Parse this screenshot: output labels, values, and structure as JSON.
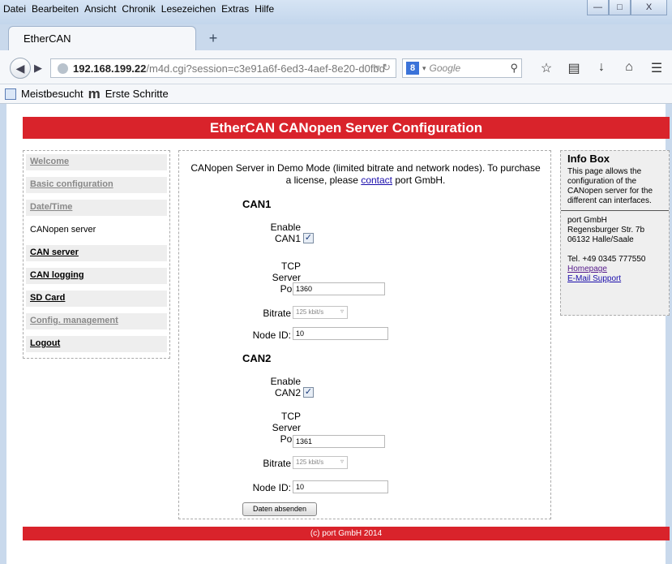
{
  "menu": {
    "items": [
      "Datei",
      "Bearbeiten",
      "Ansicht",
      "Chronik",
      "Lesezeichen",
      "Extras",
      "Hilfe"
    ]
  },
  "window_controls": {
    "minimize": "—",
    "maximize": "□",
    "close": "X"
  },
  "tab": {
    "title": "EtherCAN",
    "new_tab": "+"
  },
  "navbar": {
    "url_host": "192.168.199.22",
    "url_path": "/m4d.cgi?session=c3e91a6f-6ed3-4aef-8e20-d0fbd",
    "search_engine": "8",
    "search_placeholder": "Google"
  },
  "bookmarks": {
    "most_visited": "Meistbesucht",
    "first_steps": "Erste Schritte",
    "m_logo": "m"
  },
  "page": {
    "header": "EtherCAN CANopen Server Configuration",
    "footer": "(c) port GmbH 2014"
  },
  "nav": {
    "items": [
      {
        "label": "Welcome"
      },
      {
        "label": "Basic configuration"
      },
      {
        "label": "Date/Time"
      },
      {
        "label": "CANopen server"
      },
      {
        "label": "CAN server"
      },
      {
        "label": "CAN logging"
      },
      {
        "label": "SD Card"
      },
      {
        "label": "Config. management"
      },
      {
        "label": "Logout"
      }
    ]
  },
  "intro": {
    "text_before": "CANopen Server in Demo Mode (limited bitrate and network nodes). To purchase a license, please",
    "link": "contact",
    "text_after": "port GmbH."
  },
  "can1": {
    "title": "CAN1",
    "enable_label_1": "Enable",
    "enable_label_2": "CAN1",
    "enabled": true,
    "port_label_1": "TCP",
    "port_label_2": "Server",
    "port_label_3": "Port:",
    "port": "1360",
    "bitrate_label": "Bitrate",
    "bitrate": "125 kbit/s",
    "node_label": "Node ID:",
    "node_id": "10"
  },
  "can2": {
    "title": "CAN2",
    "enable_label_1": "Enable",
    "enable_label_2": "CAN2",
    "enabled": true,
    "port_label_1": "TCP",
    "port_label_2": "Server",
    "port_label_3": "Port:",
    "port": "1361",
    "bitrate_label": "Bitrate",
    "bitrate": "125 kbit/s",
    "node_label": "Node ID:",
    "node_id": "10"
  },
  "submit_label": "Daten absenden",
  "infobox": {
    "title": "Info Box",
    "description": "This page allows the configuration of the CANopen server for the different can interfaces.",
    "company": "port GmbH",
    "street": "Regensburger Str. 7b",
    "city": "06132 Halle/Saale",
    "phone": "Tel. +49 0345 777550",
    "homepage": "Homepage",
    "email": "E-Mail Support"
  },
  "colors": {
    "brand_red": "#d9232b"
  }
}
